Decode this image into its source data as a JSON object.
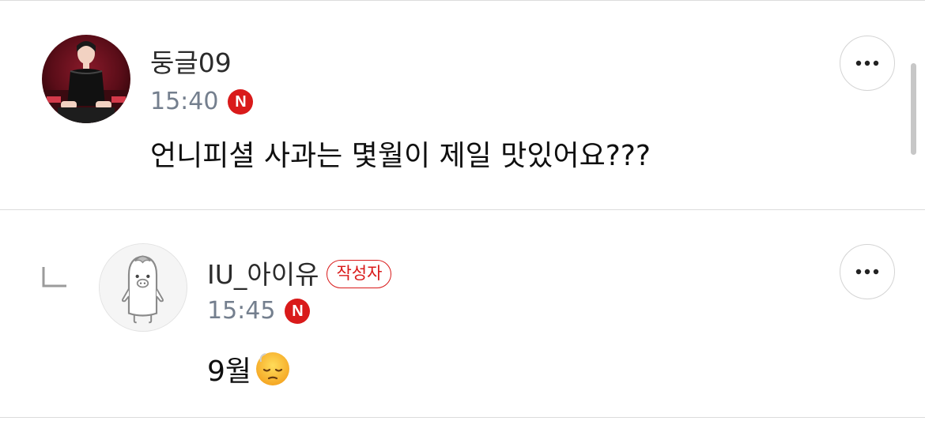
{
  "comments": [
    {
      "author": "둥글09",
      "time": "15:40",
      "badge": "N",
      "text": "언니피셜 사과는 몇월이 제일 맛있어요???",
      "avatar": "profile-photo"
    },
    {
      "author": "IU_아이유",
      "author_badge": "작성자",
      "time": "15:45",
      "badge": "N",
      "text": "9월",
      "emoji": "pensive-face-emoji",
      "avatar": "default-penguin-avatar",
      "is_reply": true
    }
  ],
  "icons": {
    "more": "more-horizontal-icon",
    "reply": "reply-arrow-icon"
  },
  "colors": {
    "accent_red": "#d91a1a",
    "time_gray": "#747f8e",
    "divider": "#dcdcdc"
  }
}
